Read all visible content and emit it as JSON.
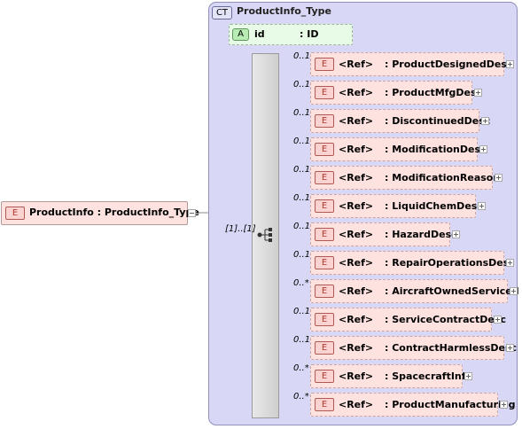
{
  "complex_type": {
    "badge": "CT",
    "name": "ProductInfo_Type"
  },
  "attribute": {
    "badge": "A",
    "name": "id",
    "type": ": ID"
  },
  "root": {
    "badge": "E",
    "label": "ProductInfo : ProductInfo_Type",
    "occurrence": "[1]..[1]"
  },
  "children": [
    {
      "badge": "E",
      "ref": "<Ref>",
      "name": ": ProductDesignedDesc",
      "occurrence": "0..1"
    },
    {
      "badge": "E",
      "ref": "<Ref>",
      "name": ": ProductMfgDesc",
      "occurrence": "0..1"
    },
    {
      "badge": "E",
      "ref": "<Ref>",
      "name": ": DiscontinuedDesc",
      "occurrence": "0..1"
    },
    {
      "badge": "E",
      "ref": "<Ref>",
      "name": ": ModificationDesc",
      "occurrence": "0..1"
    },
    {
      "badge": "E",
      "ref": "<Ref>",
      "name": ": ModificationReason",
      "occurrence": "0..1"
    },
    {
      "badge": "E",
      "ref": "<Ref>",
      "name": ": LiquidChemDesc",
      "occurrence": "0..1"
    },
    {
      "badge": "E",
      "ref": "<Ref>",
      "name": ": HazardDesc",
      "occurrence": "0..1"
    },
    {
      "badge": "E",
      "ref": "<Ref>",
      "name": ": RepairOperationsDesc",
      "occurrence": "0..1"
    },
    {
      "badge": "E",
      "ref": "<Ref>",
      "name": ": AircraftOwnedServiced",
      "occurrence": "0..*"
    },
    {
      "badge": "E",
      "ref": "<Ref>",
      "name": ": ServiceContractDesc",
      "occurrence": "0..1"
    },
    {
      "badge": "E",
      "ref": "<Ref>",
      "name": ": ContractHarmlessDesc",
      "occurrence": "0..1"
    },
    {
      "badge": "E",
      "ref": "<Ref>",
      "name": ": SpacecraftInfo",
      "occurrence": "0..*"
    },
    {
      "badge": "E",
      "ref": "<Ref>",
      "name": ": ProductManufacturing",
      "occurrence": "0..*"
    }
  ]
}
